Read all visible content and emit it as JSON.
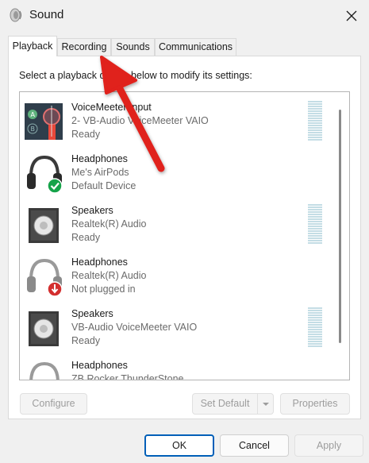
{
  "window": {
    "title": "Sound",
    "close_icon": "close-icon"
  },
  "tabs": [
    {
      "label": "Playback",
      "active": true
    },
    {
      "label": "Recording",
      "active": false
    },
    {
      "label": "Sounds",
      "active": false
    },
    {
      "label": "Communications",
      "active": false
    }
  ],
  "instruction": "Select a playback device below to modify its settings:",
  "devices": [
    {
      "name": "VoiceMeeter Input",
      "driver": "2- VB-Audio VoiceMeeter VAIO",
      "status": "Ready",
      "icon": "voicemeeter-icon",
      "has_meter": true
    },
    {
      "name": "Headphones",
      "driver": "Me's AirPods",
      "status": "Default Device",
      "icon": "headphones-default-icon",
      "has_meter": false
    },
    {
      "name": "Speakers",
      "driver": "Realtek(R) Audio",
      "status": "Ready",
      "icon": "speaker-icon",
      "has_meter": true
    },
    {
      "name": "Headphones",
      "driver": "Realtek(R) Audio",
      "status": "Not plugged in",
      "icon": "headphones-unplugged-icon",
      "has_meter": false
    },
    {
      "name": "Speakers",
      "driver": "VB-Audio VoiceMeeter VAIO",
      "status": "Ready",
      "icon": "speaker-icon",
      "has_meter": true
    },
    {
      "name": "Headphones",
      "driver": "ZB Rocker ThunderStone",
      "status": "",
      "icon": "headphones-icon",
      "has_meter": false
    }
  ],
  "buttons": {
    "configure": "Configure",
    "set_default": "Set Default",
    "properties": "Properties",
    "ok": "OK",
    "cancel": "Cancel",
    "apply": "Apply"
  },
  "colors": {
    "accent": "#005fb8",
    "annotation_arrow": "#e0201f",
    "default_check": "#16a34a",
    "unplugged_badge": "#d32f2f"
  }
}
